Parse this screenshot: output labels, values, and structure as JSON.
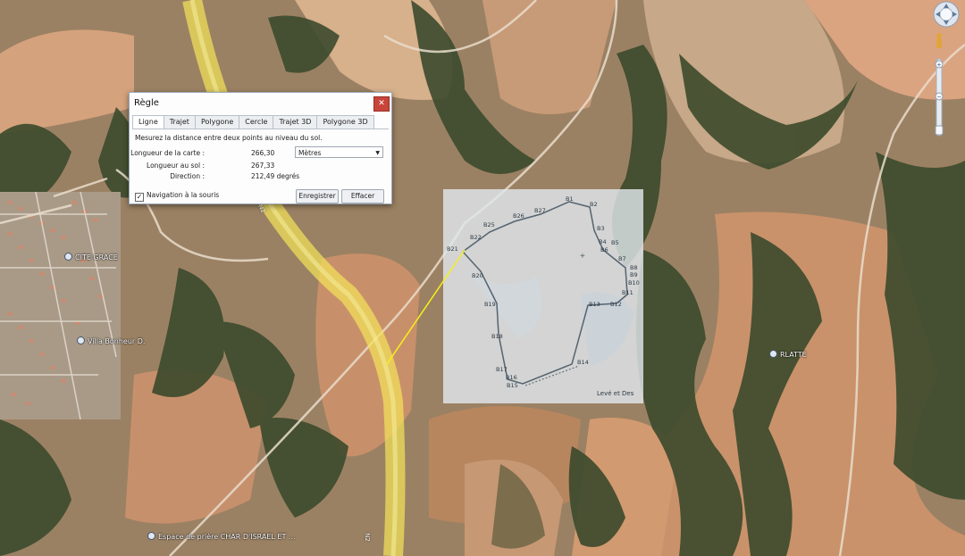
{
  "dialog": {
    "title": "Règle",
    "close_icon": "close-icon",
    "tabs": [
      "Ligne",
      "Trajet",
      "Polygone",
      "Cercle",
      "Trajet 3D",
      "Polygone 3D"
    ],
    "active_tab": "Ligne",
    "description": "Mesurez la distance entre deux points au niveau du sol.",
    "map_length_label": "Longueur de la carte :",
    "map_length_value": "266,30",
    "unit": "Mètres",
    "ground_length_label": "Longueur au sol :",
    "ground_length_value": "267,33",
    "direction_label": "Direction :",
    "direction_value": "212,49 degrés",
    "mouse_nav_label": "Navigation à la souris",
    "mouse_nav_checked": true,
    "save_label": "Enregistrer",
    "clear_label": "Effacer"
  },
  "map": {
    "places": [
      {
        "name": "CITE GRACE",
        "kind": "pin-icon"
      },
      {
        "name": "Villa Bonheur D.",
        "kind": "pin-icon"
      },
      {
        "name": "RLATTE",
        "kind": "pin-icon"
      },
      {
        "name": "Espace de prière CHAR D'ISRAEL ET ...",
        "kind": "pin-icon"
      }
    ],
    "overlay_points": [
      "B1",
      "B2",
      "B3",
      "B4",
      "B5",
      "B6",
      "B7",
      "B8",
      "B9",
      "B10",
      "B11",
      "B12",
      "B13",
      "B14",
      "B15",
      "B16",
      "B17",
      "B18",
      "B19",
      "B20",
      "B21",
      "B22",
      "B25",
      "B26",
      "B27"
    ],
    "overlay_caption": "Levé et Des",
    "road_labels": [
      "N2",
      "N2"
    ]
  },
  "controls": {
    "compass_icon": "compass-icon",
    "streetview_icon": "pegman-icon",
    "zoom_in": "+",
    "zoom_out": "−"
  },
  "colors": {
    "highway": "#f3e25a",
    "measure_line": "#f7f019",
    "close_button": "#c8443a"
  }
}
